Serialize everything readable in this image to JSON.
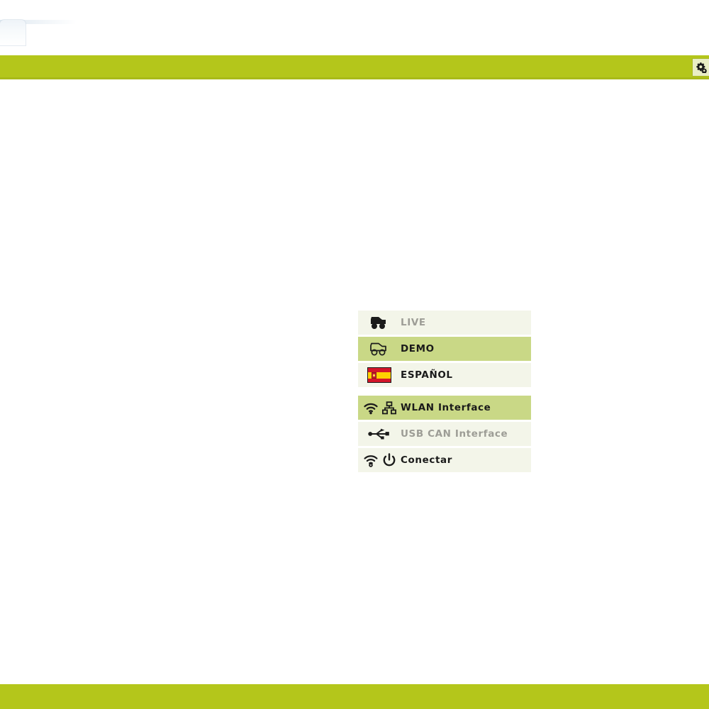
{
  "window": {
    "background_color": "#ffffff",
    "accent_color": "#b4c61b",
    "row_active_color": "#c9d886",
    "row_idle_color": "#f3f5e9",
    "disabled_text_color": "#9d9d96"
  },
  "ghost_tab": {
    "name": "browser-tab-remnant"
  },
  "header": {
    "settings_icon": "gear-icon",
    "settings_tooltip": "Settings"
  },
  "footer": {
    "name": "footer-bar"
  },
  "menu": {
    "groups": [
      {
        "name": "mode-group",
        "items": [
          {
            "id": "live",
            "label": "LIVE",
            "icons": [
              "vehicle-solid-icon"
            ],
            "state": "disabled",
            "selected": false
          },
          {
            "id": "demo",
            "label": "DEMO",
            "icons": [
              "vehicle-outline-icon"
            ],
            "state": "enabled",
            "selected": true
          },
          {
            "id": "language",
            "label": "ESPAÑOL",
            "icons": [
              "flag-spain-icon"
            ],
            "state": "enabled",
            "selected": false
          }
        ]
      },
      {
        "name": "interface-group",
        "items": [
          {
            "id": "wlan",
            "label": "WLAN Interface",
            "icons": [
              "wifi-icon",
              "network-tree-icon"
            ],
            "state": "enabled",
            "selected": true
          },
          {
            "id": "usbcan",
            "label": "USB CAN Interface",
            "icons": [
              "usb-icon"
            ],
            "state": "disabled",
            "selected": false
          },
          {
            "id": "connect",
            "label": "Conectar",
            "icons": [
              "wifi-dot-icon",
              "power-icon"
            ],
            "state": "enabled",
            "selected": false
          }
        ]
      }
    ]
  }
}
